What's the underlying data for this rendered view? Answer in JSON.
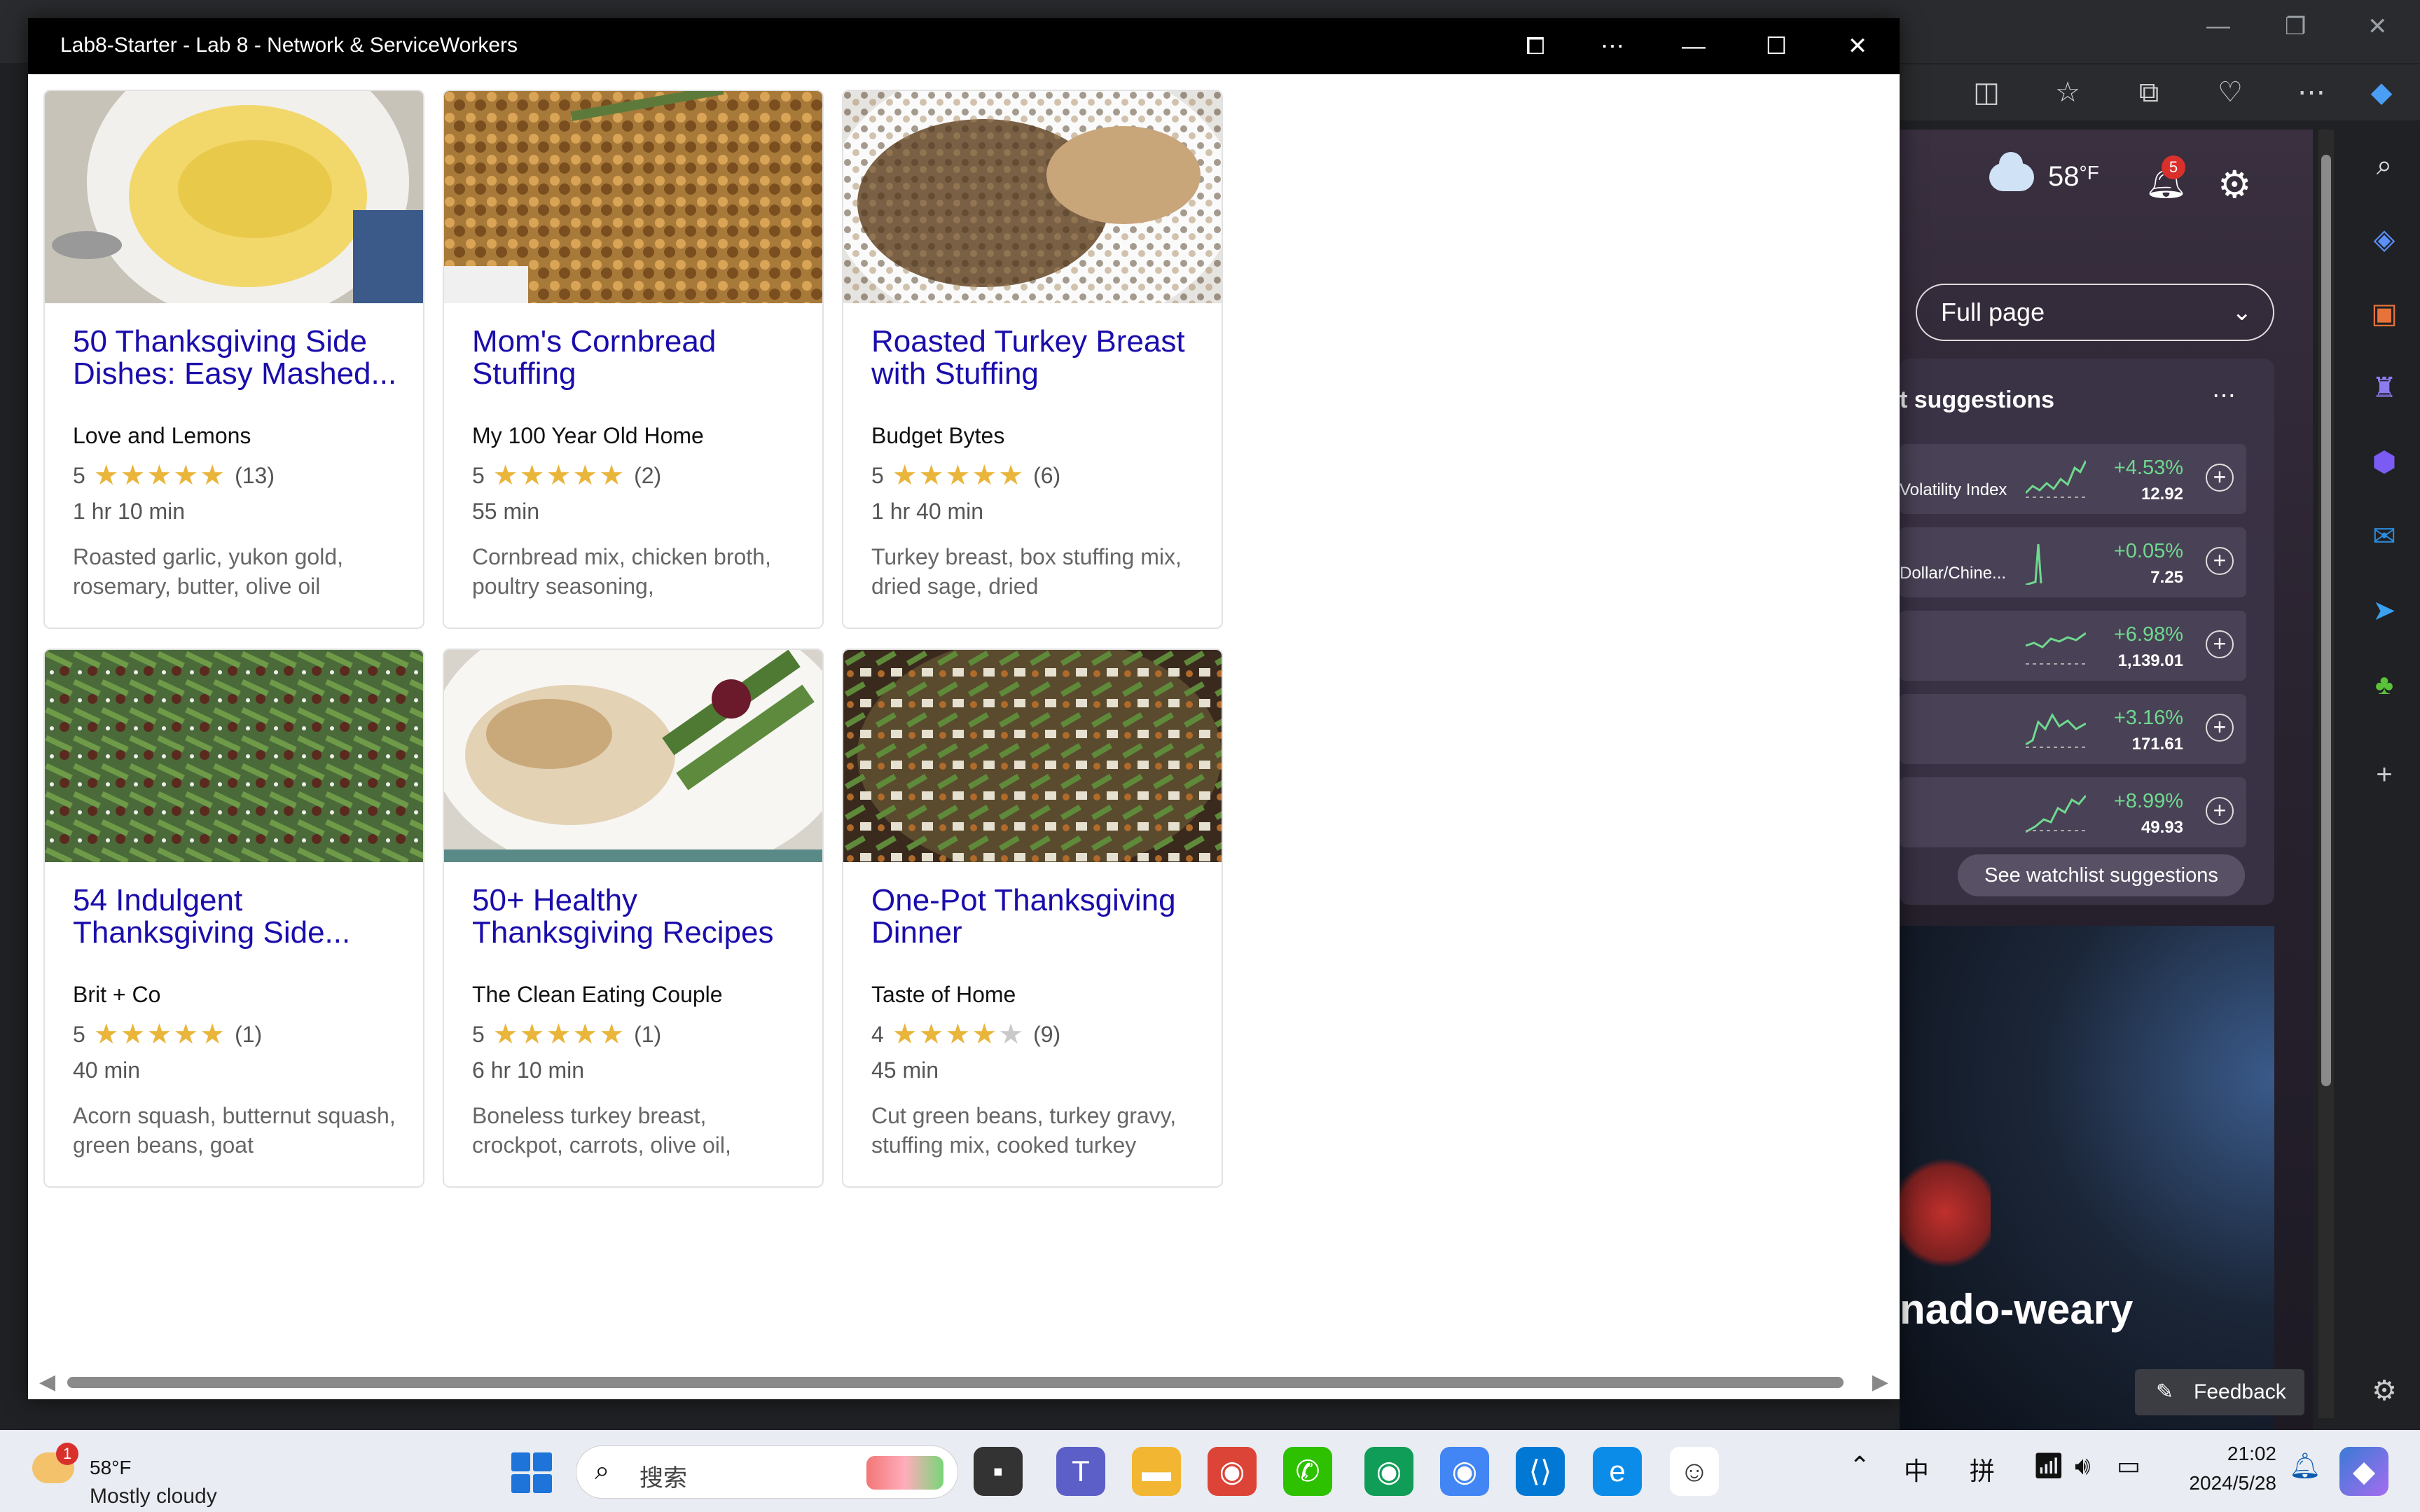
{
  "window": {
    "title": "Lab8-Starter - Lab 8 - Network & ServiceWorkers"
  },
  "recipes": [
    {
      "title": "50 Thanksgiving Side Dishes: Easy Mashed...",
      "source": "Love and Lemons",
      "rating": "5",
      "stars": 5,
      "count": "(13)",
      "time": "1 hr 10 min",
      "ingredients": "Roasted garlic, yukon gold, rosemary, butter, olive oil",
      "image": "mashed-potatoes-image"
    },
    {
      "title": "Mom's Cornbread Stuffing",
      "source": "My 100 Year Old Home",
      "rating": "5",
      "stars": 5,
      "count": "(2)",
      "time": "55 min",
      "ingredients": "Cornbread mix, chicken broth, poultry seasoning,",
      "image": "cornbread-stuffing-image"
    },
    {
      "title": "Roasted Turkey Breast with Stuffing",
      "source": "Budget Bytes",
      "rating": "5",
      "stars": 5,
      "count": "(6)",
      "time": "1 hr 40 min",
      "ingredients": "Turkey breast, box stuffing mix, dried sage, dried",
      "image": "turkey-breast-image"
    },
    {
      "title": "54 Indulgent Thanksgiving Side...",
      "source": "Brit + Co",
      "rating": "5",
      "stars": 5,
      "count": "(1)",
      "time": "40 min",
      "ingredients": "Acorn squash, butternut squash, green beans, goat",
      "image": "green-beans-image"
    },
    {
      "title": "50+ Healthy Thanksgiving Recipes",
      "source": "The Clean Eating Couple",
      "rating": "5",
      "stars": 5,
      "count": "(1)",
      "time": "6 hr 10 min",
      "ingredients": "Boneless turkey breast, crockpot, carrots, olive oil,",
      "image": "sliced-turkey-image"
    },
    {
      "title": "One-Pot Thanksgiving Dinner",
      "source": "Taste of Home",
      "rating": "4",
      "stars": 4,
      "count": "(9)",
      "time": "45 min",
      "ingredients": "Cut green beans, turkey gravy, stuffing mix, cooked turkey",
      "image": "one-pot-dinner-image"
    }
  ],
  "edge": {
    "weather_temp": "58",
    "weather_unit": "°F",
    "notification_count": "5",
    "view_select": "Full page",
    "suggestions_title": "t suggestions",
    "stocks": [
      {
        "name": "Volatility Index",
        "pct": "+4.53%",
        "value": "12.92"
      },
      {
        "name": "Dollar/Chine...",
        "pct": "+0.05%",
        "value": "7.25"
      },
      {
        "name": "",
        "pct": "+6.98%",
        "value": "1,139.01"
      },
      {
        "name": "",
        "pct": "+3.16%",
        "value": "171.61"
      },
      {
        "name": "",
        "pct": "+8.99%",
        "value": "49.93"
      }
    ],
    "watchlist_button": "See watchlist suggestions",
    "news_headline": "nado-weary",
    "feedback": "Feedback"
  },
  "taskbar": {
    "weather_temp": "58°F",
    "weather_cond": "Mostly cloudy",
    "weather_badge": "1",
    "search_placeholder": "搜索",
    "ime_lang": "中",
    "ime_mode": "拼",
    "time": "21:02",
    "date": "2024/5/28"
  },
  "colors": {
    "link": "#1a0dab",
    "star": "#e9b53a",
    "stock_green": "#6fd98f"
  }
}
